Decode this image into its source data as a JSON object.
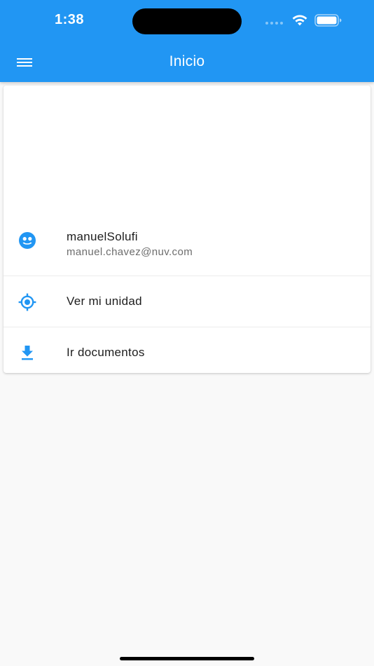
{
  "status_bar": {
    "time": "1:38"
  },
  "app_bar": {
    "title": "Inicio",
    "menu_icon": "hamburger-menu-icon",
    "background_color": "#2196f3"
  },
  "drawer": {
    "account": {
      "name": "manuelSolufi",
      "email": "manuel.chavez@nuv.com",
      "icon": "face-icon"
    },
    "items": [
      {
        "label": "Ver mi unidad",
        "icon": "gps-location-icon"
      },
      {
        "label": "Ir documentos",
        "icon": "download-icon"
      }
    ]
  },
  "colors": {
    "accent": "#2196f3",
    "text": "#1d1d1d",
    "subtext": "#6c6c6c"
  }
}
